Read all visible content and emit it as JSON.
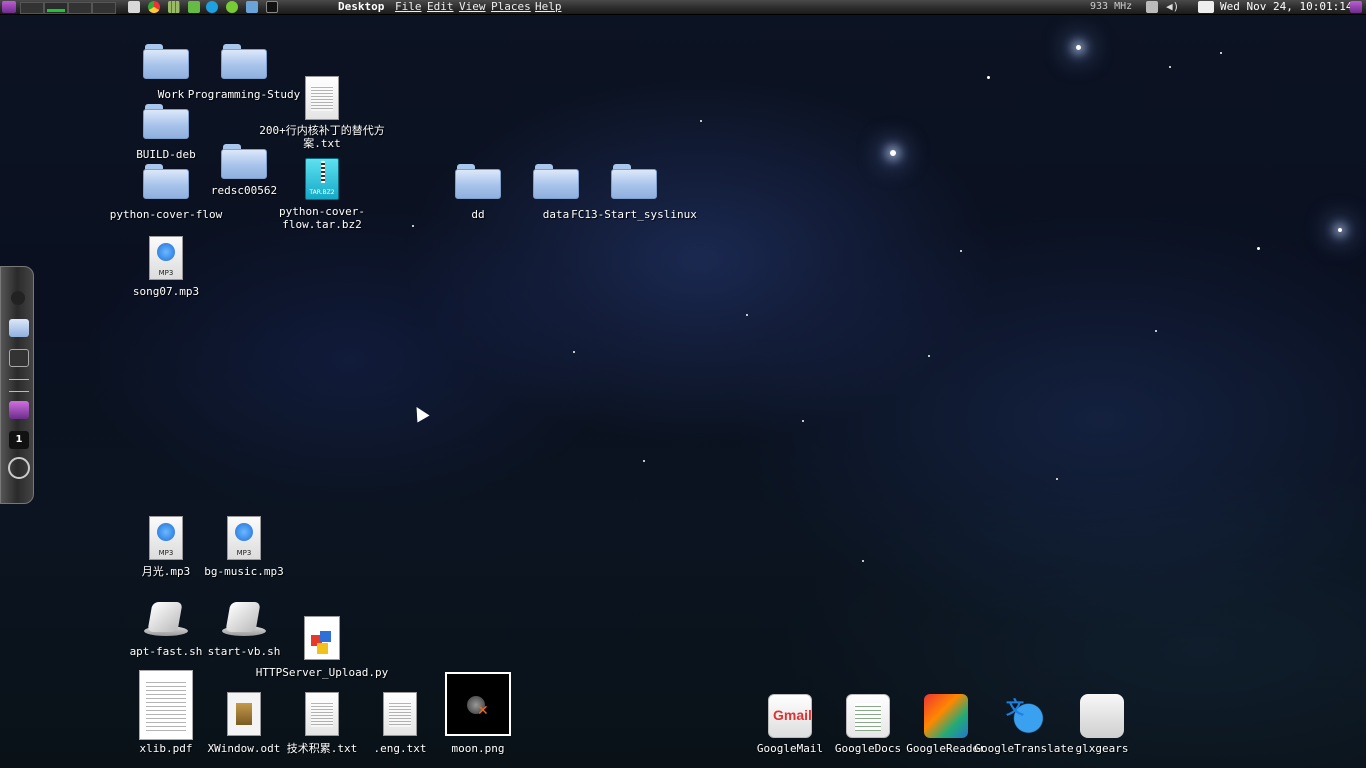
{
  "top_panel": {
    "app_title": "Desktop",
    "menus": [
      "File",
      "Edit",
      "View",
      "Places",
      "Help"
    ],
    "cpu_freq": "933 MHz",
    "clock": "Wed Nov 24, 10:01:14"
  },
  "desktop_icons": {
    "work": "Work",
    "programming_study": "Programming-Study",
    "txt_patch": "200+行内核补丁的替代方案.txt",
    "build_deb": "BUILD-deb",
    "redsc": "redsc00562",
    "python_cover_flow": "python-cover-flow",
    "python_cover_flow_tar": "python-cover-flow.tar.bz2",
    "dd": "dd",
    "data": "data",
    "fc13": "FC13-Start_syslinux",
    "song07": "song07.mp3",
    "yueguang": "月光.mp3",
    "bg_music": "bg-music.mp3",
    "apt_fast": "apt-fast.sh",
    "start_vb": "start-vb.sh",
    "httpserver": "HTTPServer_Upload.py",
    "xlib": "xlib.pdf",
    "xwindow": "XWindow.odt",
    "jishu": "技术积累.txt",
    "eng": ".eng.txt",
    "moon": "moon.png"
  },
  "file_type_tags": {
    "mp3": "MP3",
    "tarbz": "TAR.BZ2"
  },
  "side_dock": {
    "workspace_number": "1"
  },
  "apps": {
    "gmail": "GoogleMail",
    "gdocs": "GoogleDocs",
    "greader": "GoogleReader",
    "gtranslate": "GoogleTranslate",
    "glxgears": "glxgears"
  }
}
